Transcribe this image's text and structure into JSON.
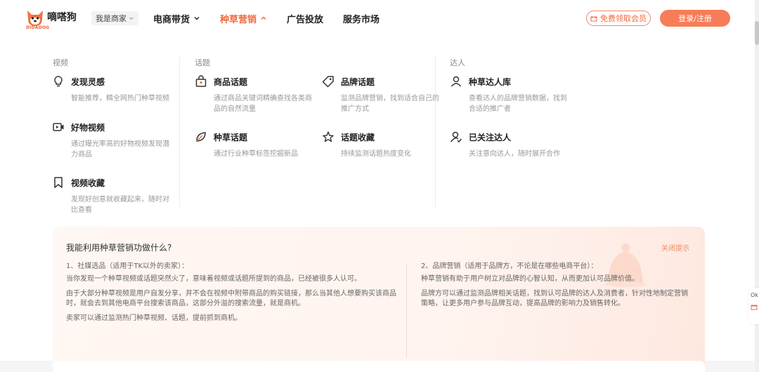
{
  "header": {
    "logo_text": "嘀嗒狗",
    "logo_sub": "DIDADOG",
    "merchant": "我是商家",
    "nav": [
      {
        "label": "电商带货",
        "has_chevron": true,
        "chevron": "down",
        "active": false
      },
      {
        "label": "种草营销",
        "has_chevron": true,
        "chevron": "up",
        "active": true
      },
      {
        "label": "广告投放",
        "has_chevron": false,
        "active": false
      },
      {
        "label": "服务市场",
        "has_chevron": false,
        "active": false
      }
    ],
    "vip_label": "免费领取会员",
    "login_label": "登录/注册"
  },
  "menu": {
    "groups": [
      "视频",
      "话题",
      "达人"
    ],
    "items": {
      "discover": {
        "title": "发现灵感",
        "desc": "智能推荐，精全网热门种草视频",
        "icon": "lightbulb-icon"
      },
      "good_video": {
        "title": "好物视频",
        "desc": "通过曝光率高的好物视频发现潜力商品",
        "icon": "video-icon"
      },
      "video_fav": {
        "title": "视频收藏",
        "desc": "发现好创意就收藏起来，随时对比查看",
        "icon": "bookmark-icon"
      },
      "product_topic": {
        "title": "商品话题",
        "desc": "通过商品关键词精确查找各类商品的自然流量",
        "icon": "shop-bag-icon"
      },
      "brand_topic": {
        "title": "品牌话题",
        "desc": "监测品牌营销，找到适合自己的推广方式",
        "icon": "tag-icon"
      },
      "seed_topic": {
        "title": "种草话题",
        "desc": "通过行业种草标签挖掘新品",
        "icon": "leaf-icon"
      },
      "topic_fav": {
        "title": "话题收藏",
        "desc": "持续监测话题热度变化",
        "icon": "star-icon"
      },
      "kol_lib": {
        "title": "种草达人库",
        "desc": "查看达人的品牌营销数据，找到合适的推广者",
        "icon": "user-icon"
      },
      "kol_follow": {
        "title": "已关注达人",
        "desc": "关注意向达人，随时展开合作",
        "icon": "user-check-icon"
      }
    }
  },
  "info": {
    "title": "我能利用种草营销功做什么?",
    "close": "关闭提示",
    "left": {
      "head": "1、社媒选品（适用于TK以外的卖家）：",
      "p1": "当你发现一个种草视频或话题突然火了，意味着视频或话题所提到的商品，已经被很多人认可。",
      "p2": "由于大部分种草视频是用户自发分享，并不会在视频中附带商品的购买链接，那么当其他人想要购买该商品时，就会去到其他电商平台搜索该商品，这部分外溢的搜索流量，就是商机。",
      "p3": "卖家可以通过监测热门种草视频、话题，提前抓到商机。"
    },
    "right": {
      "head": "2、品牌营销（适用于品牌方，不论是在哪些电商平台）：",
      "p1": "种草营销有助于用户树立对品牌的心智认知，从而更加认可品牌价值。",
      "p2": "品牌方可以通过监测品牌相关话题，找到认可品牌的达人及消费者，针对性地制定营销策略，让更多用户参与品牌互动，提高品牌的影响力及销售转化。"
    }
  },
  "side": {
    "label": "Ok"
  },
  "colors": {
    "accent": "#f06a3f",
    "button": "#f77c58"
  }
}
